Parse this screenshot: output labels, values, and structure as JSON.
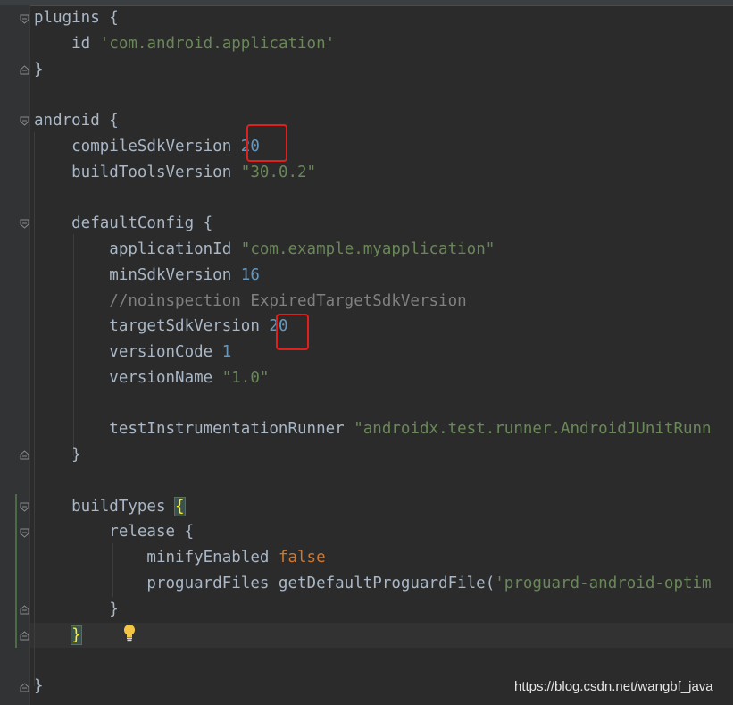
{
  "code_lines": {
    "l1": {
      "a": "plugins {"
    },
    "l2": {
      "a": "    id ",
      "b": "'com.android.application'"
    },
    "l3": {
      "a": "}"
    },
    "l5": {
      "a": "android {"
    },
    "l6": {
      "a": "    compileSdkVersion ",
      "b": "20"
    },
    "l7": {
      "a": "    buildToolsVersion ",
      "b": "\"30.0.2\""
    },
    "l9": {
      "a": "    defaultConfig {"
    },
    "l10": {
      "a": "        applicationId ",
      "b": "\"com.example.myapplication\""
    },
    "l11": {
      "a": "        minSdkVersion ",
      "b": "16"
    },
    "l12": {
      "a": "        //noinspection ExpiredTargetSdkVersion"
    },
    "l13": {
      "a": "        targetSdkVersion ",
      "b": "20"
    },
    "l14": {
      "a": "        versionCode ",
      "b": "1"
    },
    "l15": {
      "a": "        versionName ",
      "b": "\"1.0\""
    },
    "l17": {
      "a": "        testInstrumentationRunner ",
      "b": "\"androidx.test.runner.AndroidJUnitRunn"
    },
    "l18": {
      "a": "    }"
    },
    "l20": {
      "a": "    buildTypes ",
      "b": "{"
    },
    "l21": {
      "a": "        release {"
    },
    "l22": {
      "a": "            minifyEnabled ",
      "b": "false"
    },
    "l23": {
      "a": "            proguardFiles getDefaultProguardFile(",
      "b": "'proguard-android-optim"
    },
    "l24": {
      "a": "        }"
    },
    "l25": {
      "a": "    ",
      "b": "}"
    },
    "l27": {
      "a": "}"
    }
  },
  "icons": {
    "fold": "fold-marker-icon",
    "bulb": "lightbulb-icon"
  },
  "colors": {
    "background": "#2b2b2b",
    "keyword": "#cc7832",
    "string": "#6a8759",
    "number": "#6897bb",
    "comment": "#808080",
    "highlight": "#e0201c"
  },
  "watermark": "https://blog.csdn.net/wangbf_java"
}
